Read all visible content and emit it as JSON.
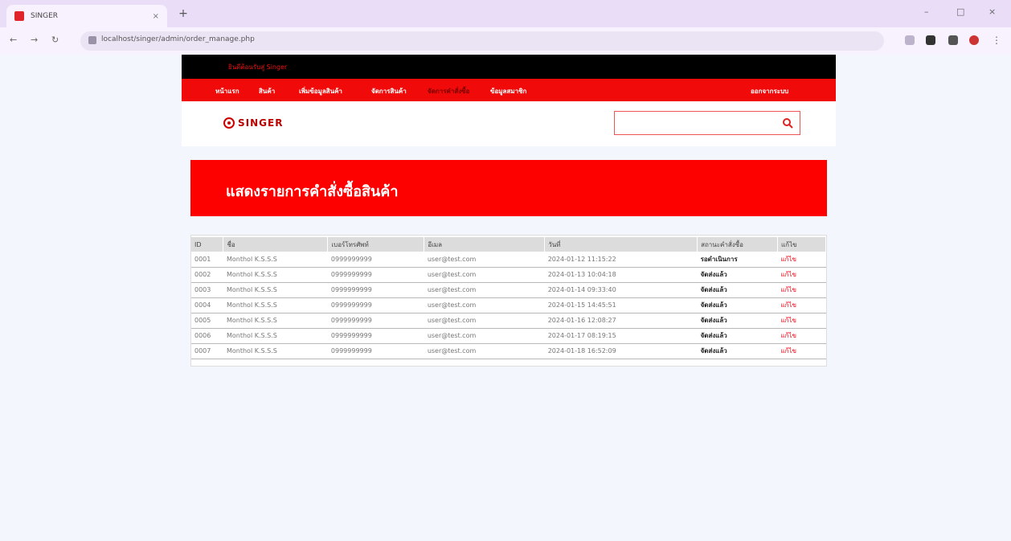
{
  "browser": {
    "tab_title": "SINGER",
    "tab_close": "×",
    "new_tab": "+",
    "url": "localhost/singer/admin/order_manage.php",
    "window_controls": [
      "–",
      "□",
      "×"
    ],
    "back": "←",
    "forward": "→",
    "reload": "↻"
  },
  "site": {
    "promo_text": "ยินดีต้อนรับสู่ Singer",
    "nav": [
      "หน้าแรก",
      "สินค้า",
      "เพิ่มข้อมูลสินค้า",
      "จัดการสินค้า",
      "จัดการคำสั่งซื้อ",
      "ข้อมูลสมาชิก"
    ],
    "nav_active_index": 4,
    "account": "ออกจากระบบ",
    "logo_text": "SINGER",
    "search_placeholder": ""
  },
  "banner": {
    "title": "แสดงรายการคำสั่งซื้อสินค้า"
  },
  "table": {
    "headers": [
      "ID",
      "ชื่อ",
      "เบอร์โทรศัพท์",
      "อีเมล",
      "วันที่",
      "สถานะคำสั่งซื้อ",
      "แก้ไข"
    ],
    "rows": [
      [
        "0001",
        "Monthol K.S.S.S",
        "0999999999",
        "user@test.com",
        "2024-01-12 11:15:22",
        "รอดำเนินการ",
        "แก้ไข"
      ],
      [
        "0002",
        "Monthol K.S.S.S",
        "0999999999",
        "user@test.com",
        "2024-01-13 10:04:18",
        "จัดส่งแล้ว",
        "แก้ไข"
      ],
      [
        "0003",
        "Monthol K.S.S.S",
        "0999999999",
        "user@test.com",
        "2024-01-14 09:33:40",
        "จัดส่งแล้ว",
        "แก้ไข"
      ],
      [
        "0004",
        "Monthol K.S.S.S",
        "0999999999",
        "user@test.com",
        "2024-01-15 14:45:51",
        "จัดส่งแล้ว",
        "แก้ไข"
      ],
      [
        "0005",
        "Monthol K.S.S.S",
        "0999999999",
        "user@test.com",
        "2024-01-16 12:08:27",
        "จัดส่งแล้ว",
        "แก้ไข"
      ],
      [
        "0006",
        "Monthol K.S.S.S",
        "0999999999",
        "user@test.com",
        "2024-01-17 08:19:15",
        "จัดส่งแล้ว",
        "แก้ไข"
      ],
      [
        "0007",
        "Monthol K.S.S.S",
        "0999999999",
        "user@test.com",
        "2024-01-18 16:52:09",
        "จัดส่งแล้ว",
        "แก้ไข"
      ]
    ]
  },
  "colors": {
    "brand_red": "#fd0000",
    "top_black": "#000000",
    "chrome_purple": "#e9ddf8"
  }
}
